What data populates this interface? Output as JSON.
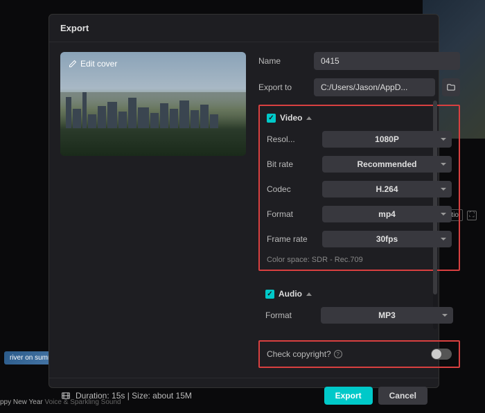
{
  "dialog": {
    "title": "Export",
    "edit_cover": "Edit cover",
    "name_label": "Name",
    "name_value": "0415",
    "export_to_label": "Export to",
    "export_to_value": "C:/Users/Jason/AppD..."
  },
  "video": {
    "section": "Video",
    "resolution_label": "Resol...",
    "resolution_value": "1080P",
    "bitrate_label": "Bit rate",
    "bitrate_value": "Recommended",
    "codec_label": "Codec",
    "codec_value": "H.264",
    "format_label": "Format",
    "format_value": "mp4",
    "framerate_label": "Frame rate",
    "framerate_value": "30fps",
    "color_space": "Color space: SDR - Rec.709"
  },
  "audio": {
    "section": "Audio",
    "format_label": "Format",
    "format_value": "MP3"
  },
  "copyright": {
    "label": "Check copyright?"
  },
  "footer": {
    "meta": "Duration: 15s | Size: about 15M",
    "export": "Export",
    "cancel": "Cancel"
  },
  "bg": {
    "ratio": "Ratio",
    "thumb1": "river on summe",
    "thumb2a": "ppy New Year",
    "thumb2b": "Voice & Sparkling Sound"
  }
}
